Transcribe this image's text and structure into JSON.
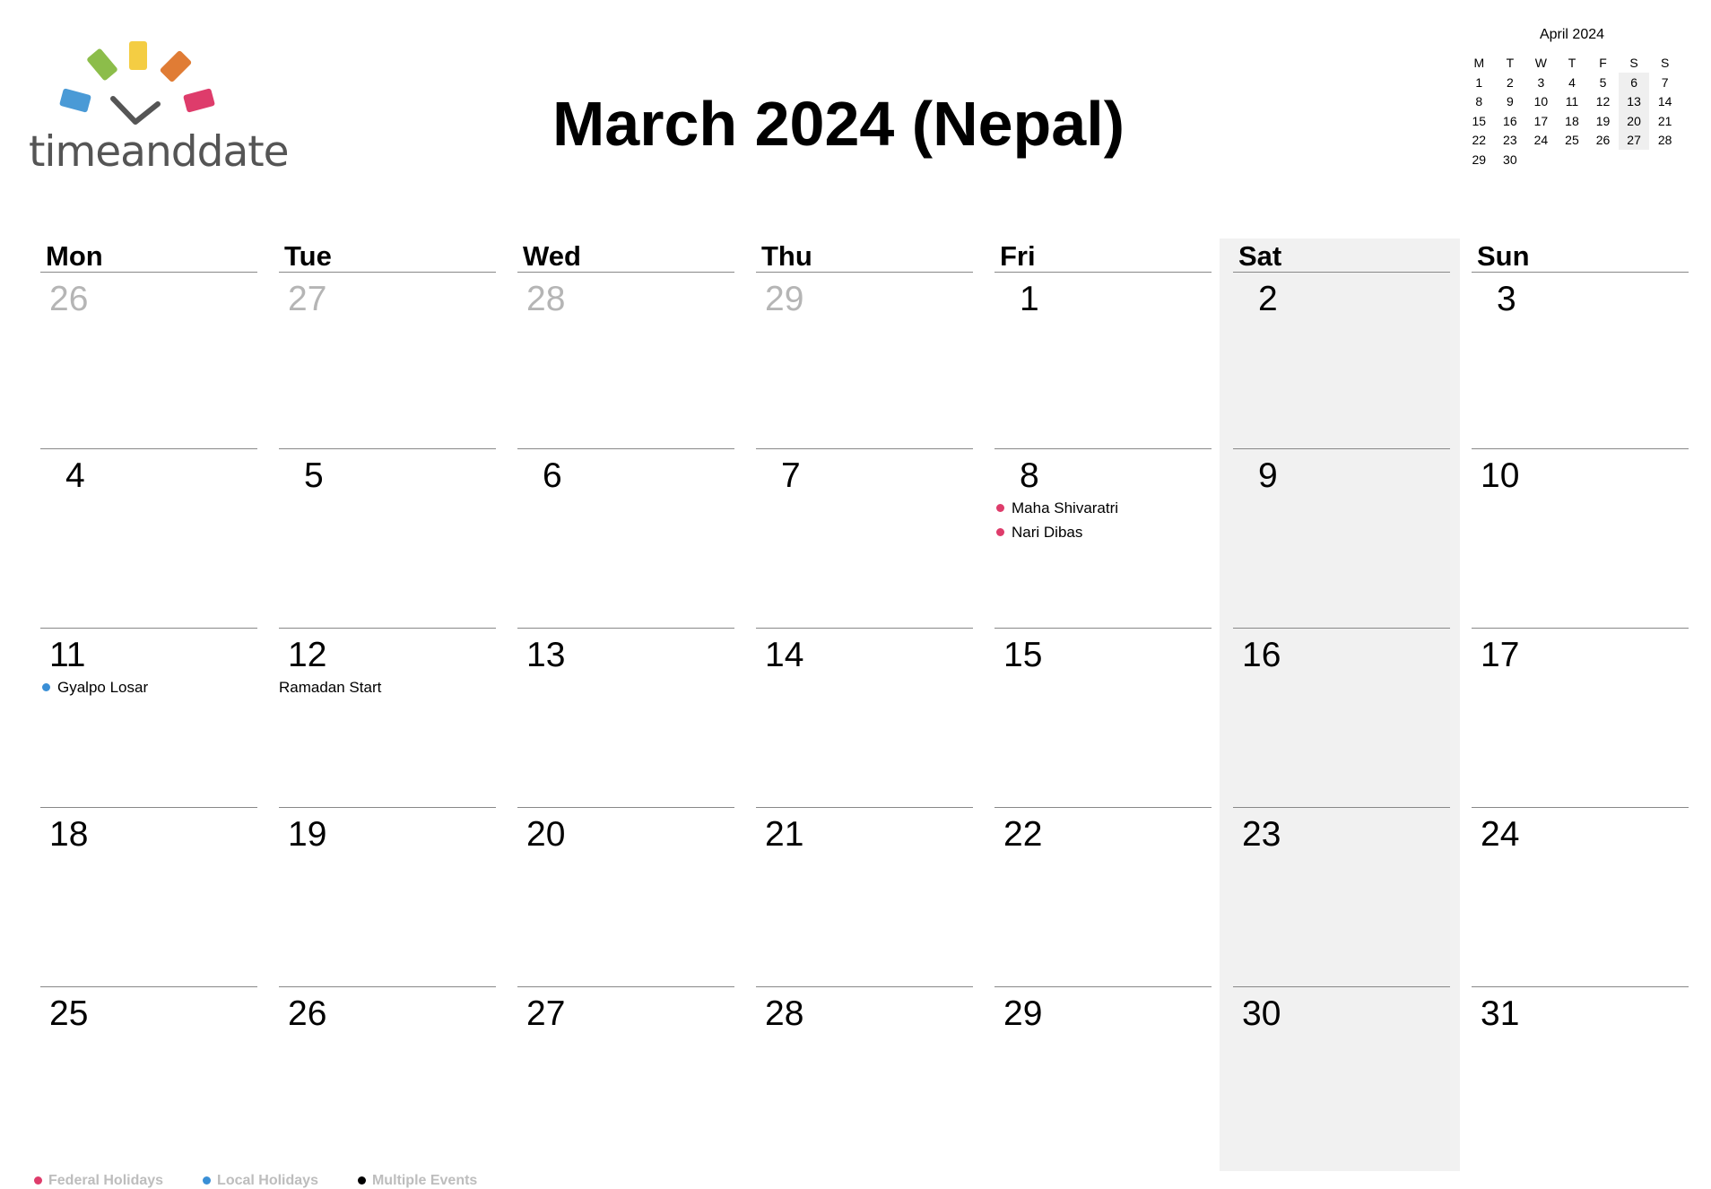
{
  "logo": {
    "text": "timeanddate",
    "colors": [
      "#4a9ad6",
      "#8cbd4a",
      "#f4cd43",
      "#e07c35",
      "#de3c6b"
    ]
  },
  "title": "March 2024 (Nepal)",
  "mini_calendar": {
    "title": "April 2024",
    "weekdays": [
      "M",
      "T",
      "W",
      "T",
      "F",
      "S",
      "S"
    ],
    "weeks": [
      [
        "1",
        "2",
        "3",
        "4",
        "5",
        "6",
        "7"
      ],
      [
        "8",
        "9",
        "10",
        "11",
        "12",
        "13",
        "14"
      ],
      [
        "15",
        "16",
        "17",
        "18",
        "19",
        "20",
        "21"
      ],
      [
        "22",
        "23",
        "24",
        "25",
        "26",
        "27",
        "28"
      ],
      [
        "29",
        "30",
        "",
        "",
        "",
        "",
        ""
      ]
    ]
  },
  "calendar": {
    "weekdays": [
      "Mon",
      "Tue",
      "Wed",
      "Thu",
      "Fri",
      "Sat",
      "Sun"
    ],
    "weeks": [
      [
        {
          "day": "26",
          "other": true,
          "events": []
        },
        {
          "day": "27",
          "other": true,
          "events": []
        },
        {
          "day": "28",
          "other": true,
          "events": []
        },
        {
          "day": "29",
          "other": true,
          "events": []
        },
        {
          "day": "1",
          "other": false,
          "events": []
        },
        {
          "day": "2",
          "other": false,
          "events": []
        },
        {
          "day": "3",
          "other": false,
          "events": []
        }
      ],
      [
        {
          "day": "4",
          "other": false,
          "events": []
        },
        {
          "day": "5",
          "other": false,
          "events": []
        },
        {
          "day": "6",
          "other": false,
          "events": []
        },
        {
          "day": "7",
          "other": false,
          "events": []
        },
        {
          "day": "8",
          "other": false,
          "events": [
            {
              "name": "Maha Shivaratri",
              "type": "federal"
            },
            {
              "name": "Nari Dibas",
              "type": "federal"
            }
          ]
        },
        {
          "day": "9",
          "other": false,
          "events": []
        },
        {
          "day": "10",
          "other": false,
          "events": []
        }
      ],
      [
        {
          "day": "11",
          "other": false,
          "events": [
            {
              "name": "Gyalpo Losar",
              "type": "local"
            }
          ]
        },
        {
          "day": "12",
          "other": false,
          "events": [
            {
              "name": "Ramadan Start",
              "type": "none"
            }
          ]
        },
        {
          "day": "13",
          "other": false,
          "events": []
        },
        {
          "day": "14",
          "other": false,
          "events": []
        },
        {
          "day": "15",
          "other": false,
          "events": []
        },
        {
          "day": "16",
          "other": false,
          "events": []
        },
        {
          "day": "17",
          "other": false,
          "events": []
        }
      ],
      [
        {
          "day": "18",
          "other": false,
          "events": []
        },
        {
          "day": "19",
          "other": false,
          "events": []
        },
        {
          "day": "20",
          "other": false,
          "events": []
        },
        {
          "day": "21",
          "other": false,
          "events": []
        },
        {
          "day": "22",
          "other": false,
          "events": []
        },
        {
          "day": "23",
          "other": false,
          "events": []
        },
        {
          "day": "24",
          "other": false,
          "events": []
        }
      ],
      [
        {
          "day": "25",
          "other": false,
          "events": []
        },
        {
          "day": "26",
          "other": false,
          "events": []
        },
        {
          "day": "27",
          "other": false,
          "events": []
        },
        {
          "day": "28",
          "other": false,
          "events": []
        },
        {
          "day": "29",
          "other": false,
          "events": []
        },
        {
          "day": "30",
          "other": false,
          "events": []
        },
        {
          "day": "31",
          "other": false,
          "events": []
        }
      ]
    ]
  },
  "event_colors": {
    "federal": "#de3c6b",
    "local": "#3a8fd6",
    "multiple": "#000000"
  },
  "legend": [
    {
      "label": "Federal Holidays",
      "type": "federal"
    },
    {
      "label": "Local Holidays",
      "type": "local"
    },
    {
      "label": "Multiple Events",
      "type": "multiple"
    }
  ]
}
